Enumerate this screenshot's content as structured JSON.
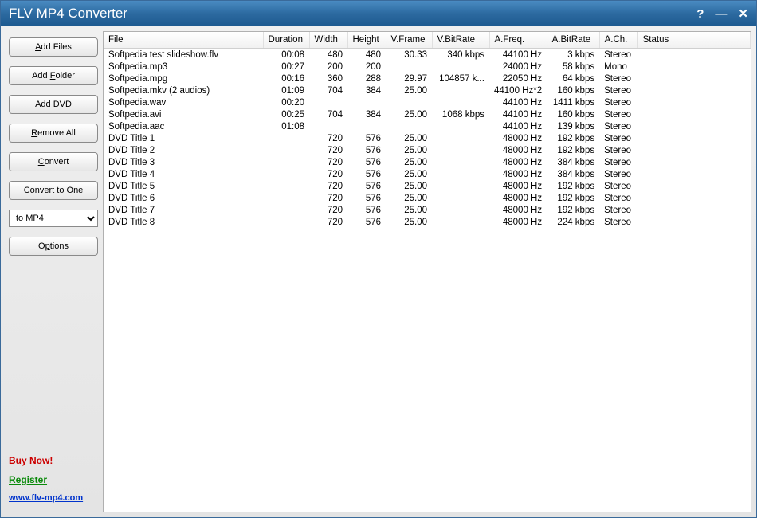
{
  "window": {
    "title": "FLV MP4 Converter",
    "help": "?",
    "minimize": "—",
    "close": "✕"
  },
  "sidebar": {
    "add_files": "Add Files",
    "add_folder": "Add Folder",
    "add_dvd": "Add DVD",
    "remove_all": "Remove All",
    "convert": "Convert",
    "convert_to_one": "Convert to One",
    "format_selected": "to MP4",
    "options": "Options",
    "buy_now": "Buy Now!",
    "register": "Register",
    "site": "www.flv-mp4.com"
  },
  "table": {
    "headers": {
      "file": "File",
      "duration": "Duration",
      "width": "Width",
      "height": "Height",
      "vframe": "V.Frame",
      "vbitrate": "V.BitRate",
      "afreq": "A.Freq.",
      "abitrate": "A.BitRate",
      "ach": "A.Ch.",
      "status": "Status"
    },
    "rows": [
      {
        "file": "Softpedia test slideshow.flv",
        "duration": "00:08",
        "width": "480",
        "height": "480",
        "vframe": "30.33",
        "vbitrate": "340 kbps",
        "afreq": "44100 Hz",
        "abitrate": "3 kbps",
        "ach": "Stereo",
        "status": ""
      },
      {
        "file": "Softpedia.mp3",
        "duration": "00:27",
        "width": "200",
        "height": "200",
        "vframe": "",
        "vbitrate": "",
        "afreq": "24000 Hz",
        "abitrate": "58 kbps",
        "ach": "Mono",
        "status": ""
      },
      {
        "file": "Softpedia.mpg",
        "duration": "00:16",
        "width": "360",
        "height": "288",
        "vframe": "29.97",
        "vbitrate": "104857 k...",
        "afreq": "22050 Hz",
        "abitrate": "64 kbps",
        "ach": "Stereo",
        "status": ""
      },
      {
        "file": "Softpedia.mkv (2 audios)",
        "duration": "01:09",
        "width": "704",
        "height": "384",
        "vframe": "25.00",
        "vbitrate": "",
        "afreq": "44100 Hz*2",
        "abitrate": "160 kbps",
        "ach": "Stereo",
        "status": ""
      },
      {
        "file": "Softpedia.wav",
        "duration": "00:20",
        "width": "",
        "height": "",
        "vframe": "",
        "vbitrate": "",
        "afreq": "44100 Hz",
        "abitrate": "1411 kbps",
        "ach": "Stereo",
        "status": ""
      },
      {
        "file": "Softpedia.avi",
        "duration": "00:25",
        "width": "704",
        "height": "384",
        "vframe": "25.00",
        "vbitrate": "1068 kbps",
        "afreq": "44100 Hz",
        "abitrate": "160 kbps",
        "ach": "Stereo",
        "status": ""
      },
      {
        "file": "Softpedia.aac",
        "duration": "01:08",
        "width": "",
        "height": "",
        "vframe": "",
        "vbitrate": "",
        "afreq": "44100 Hz",
        "abitrate": "139 kbps",
        "ach": "Stereo",
        "status": ""
      },
      {
        "file": "DVD Title 1",
        "duration": "",
        "width": "720",
        "height": "576",
        "vframe": "25.00",
        "vbitrate": "",
        "afreq": "48000 Hz",
        "abitrate": "192 kbps",
        "ach": "Stereo",
        "status": ""
      },
      {
        "file": "DVD Title 2",
        "duration": "",
        "width": "720",
        "height": "576",
        "vframe": "25.00",
        "vbitrate": "",
        "afreq": "48000 Hz",
        "abitrate": "192 kbps",
        "ach": "Stereo",
        "status": ""
      },
      {
        "file": "DVD Title 3",
        "duration": "",
        "width": "720",
        "height": "576",
        "vframe": "25.00",
        "vbitrate": "",
        "afreq": "48000 Hz",
        "abitrate": "384 kbps",
        "ach": "Stereo",
        "status": ""
      },
      {
        "file": "DVD Title 4",
        "duration": "",
        "width": "720",
        "height": "576",
        "vframe": "25.00",
        "vbitrate": "",
        "afreq": "48000 Hz",
        "abitrate": "384 kbps",
        "ach": "Stereo",
        "status": ""
      },
      {
        "file": "DVD Title 5",
        "duration": "",
        "width": "720",
        "height": "576",
        "vframe": "25.00",
        "vbitrate": "",
        "afreq": "48000 Hz",
        "abitrate": "192 kbps",
        "ach": "Stereo",
        "status": ""
      },
      {
        "file": "DVD Title 6",
        "duration": "",
        "width": "720",
        "height": "576",
        "vframe": "25.00",
        "vbitrate": "",
        "afreq": "48000 Hz",
        "abitrate": "192 kbps",
        "ach": "Stereo",
        "status": ""
      },
      {
        "file": "DVD Title 7",
        "duration": "",
        "width": "720",
        "height": "576",
        "vframe": "25.00",
        "vbitrate": "",
        "afreq": "48000 Hz",
        "abitrate": "192 kbps",
        "ach": "Stereo",
        "status": ""
      },
      {
        "file": "DVD Title 8",
        "duration": "",
        "width": "720",
        "height": "576",
        "vframe": "25.00",
        "vbitrate": "",
        "afreq": "48000 Hz",
        "abitrate": "224 kbps",
        "ach": "Stereo",
        "status": ""
      }
    ]
  }
}
